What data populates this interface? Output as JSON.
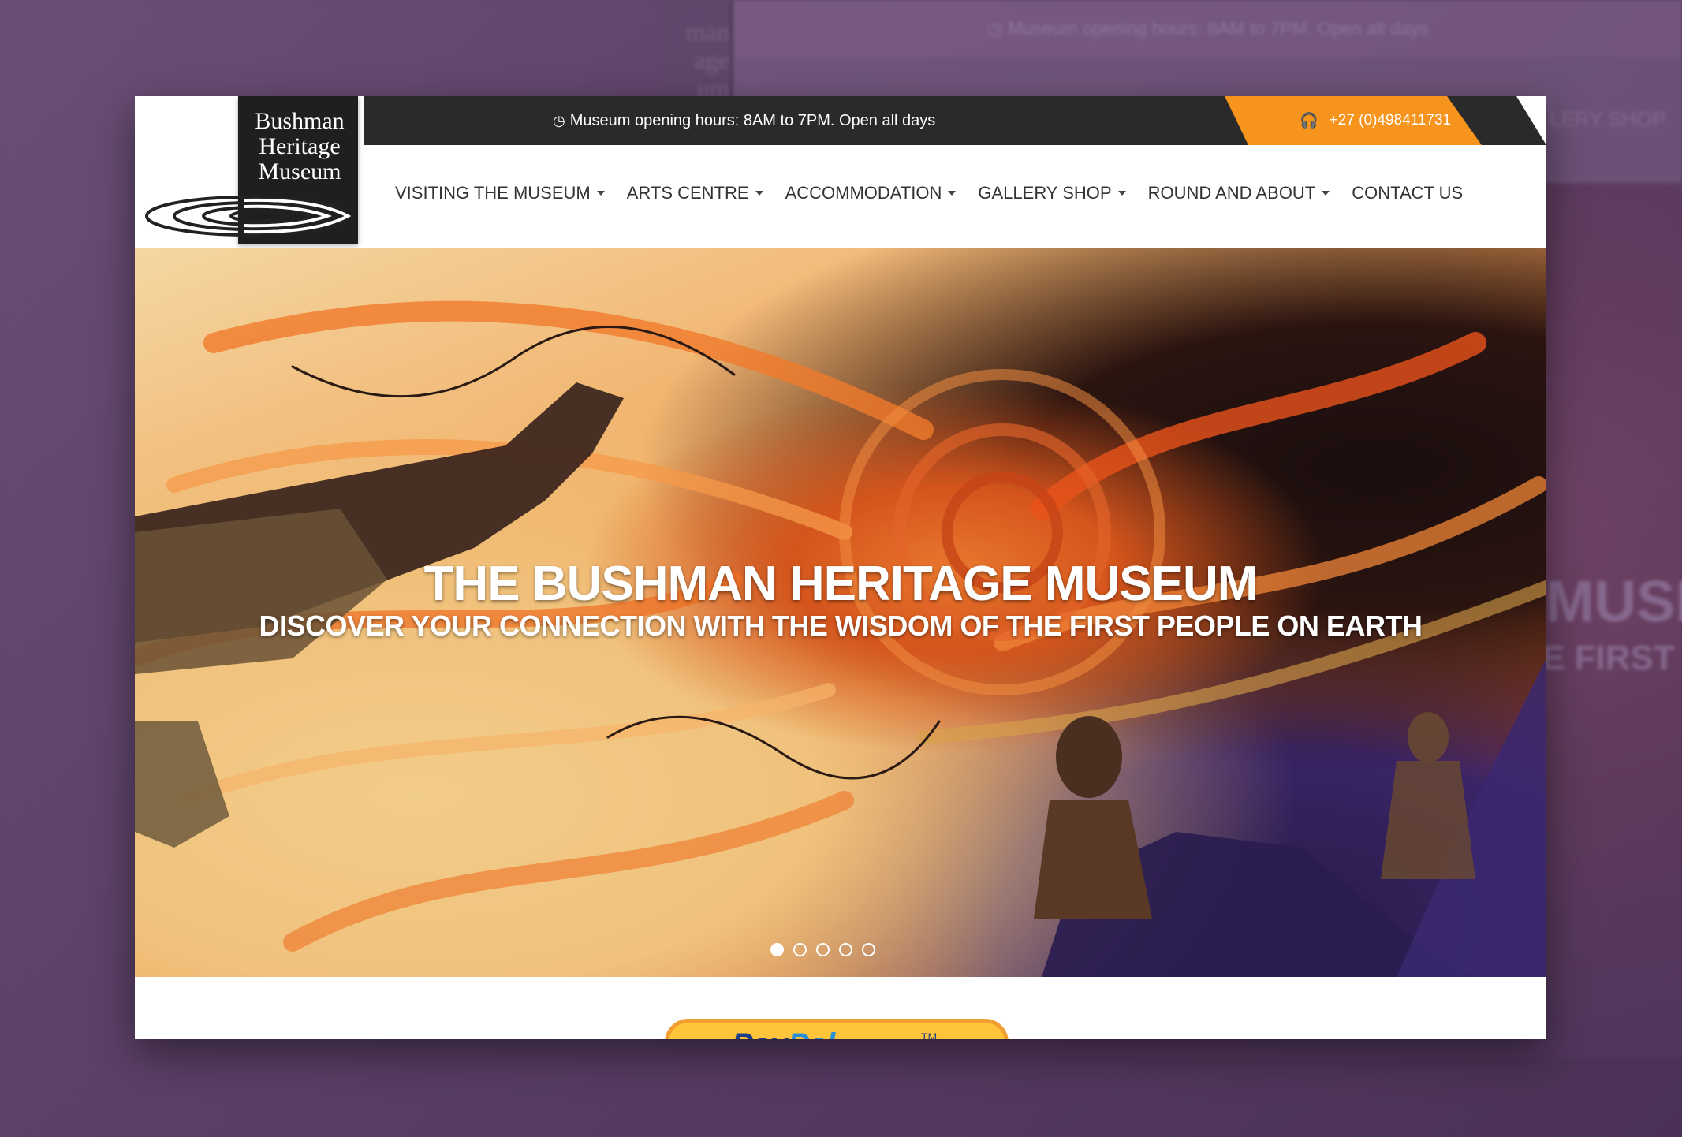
{
  "background": {
    "topbar_text": "Museum opening hours: 8AM to 7PM. Open all days",
    "nav_fragment": "LERY SHOP",
    "hero_fragment_1": "MUSE",
    "hero_fragment_2": "E FIRST",
    "logo_fragment": "man\nage\num"
  },
  "logo": {
    "lines": [
      "Bushman",
      "Heritage",
      "Museum"
    ]
  },
  "topbar": {
    "hours_text": "Museum opening hours: 8AM to 7PM. Open all days",
    "phone_text": "+27 (0)498411731",
    "accent_color": "#f7941d",
    "bar_color": "#2a2a2a"
  },
  "nav": {
    "items": [
      {
        "label": "VISITING THE MUSEUM",
        "dropdown": true
      },
      {
        "label": "ARTS CENTRE",
        "dropdown": true
      },
      {
        "label": "ACCOMMODATION",
        "dropdown": true
      },
      {
        "label": "GALLERY SHOP",
        "dropdown": true
      },
      {
        "label": "ROUND AND ABOUT",
        "dropdown": true
      },
      {
        "label": "CONTACT US",
        "dropdown": false
      }
    ]
  },
  "hero": {
    "title": "THE BUSHMAN HERITAGE MUSEUM",
    "subtitle": "DISCOVER YOUR CONNECTION WITH THE WISDOM OF THE FIRST PEOPLE ON EARTH",
    "slides_total": 5,
    "active_slide": 1
  },
  "paypal": {
    "part1": "Pay",
    "part2": "Pal",
    "tm": "TM"
  }
}
